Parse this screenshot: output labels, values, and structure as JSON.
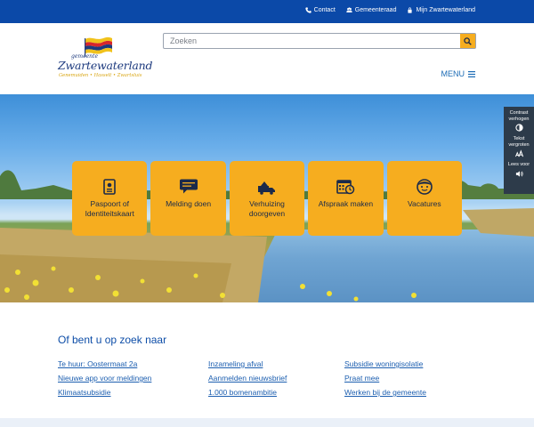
{
  "topbar": {
    "links": [
      {
        "label": "Contact",
        "icon": "phone-icon"
      },
      {
        "label": "Gemeenteraad",
        "icon": "council-icon"
      },
      {
        "label": "Mijn Zwartewaterland",
        "icon": "lock-icon"
      }
    ]
  },
  "logo": {
    "prefix": "gemeente",
    "name": "Zwartewaterland",
    "towns": "Genemuiden • Hasselt • Zwartsluis"
  },
  "search": {
    "placeholder": "Zoeken"
  },
  "menu": {
    "label": "MENU"
  },
  "tiles": [
    {
      "line1": "Paspoort of",
      "line2": "Identiteitskaart",
      "icon": "passport-icon"
    },
    {
      "line1": "Melding doen",
      "line2": "",
      "icon": "chat-icon"
    },
    {
      "line1": "Verhuizing",
      "line2": "doorgeven",
      "icon": "moving-truck-icon"
    },
    {
      "line1": "Afspraak maken",
      "line2": "",
      "icon": "calendar-clock-icon"
    },
    {
      "line1": "Vacatures",
      "line2": "",
      "icon": "person-face-icon"
    }
  ],
  "tools": [
    {
      "line1": "Contrast",
      "line2": "verhogen",
      "icon": "contrast-icon"
    },
    {
      "line1": "Tekst",
      "line2": "vergroten",
      "icon": "text-size-icon"
    },
    {
      "line1": "Lees voor",
      "line2": "",
      "icon": "speaker-icon"
    }
  ],
  "lookup": {
    "heading": "Of bent u op zoek naar",
    "columns": [
      [
        "Te huur: Oostermaat 2a",
        "Nieuwe app voor meldingen",
        "Klimaatsubsidie"
      ],
      [
        "Inzameling afval",
        "Aanmelden nieuwsbrief",
        "1.000 bomenambitie"
      ],
      [
        "Subsidie woningisolatie",
        "Praat mee",
        "Werken bij de gemeente"
      ]
    ]
  },
  "colors": {
    "topbar": "#0b49a8",
    "accent": "#f6ad1f",
    "link": "#1d5fb0"
  }
}
